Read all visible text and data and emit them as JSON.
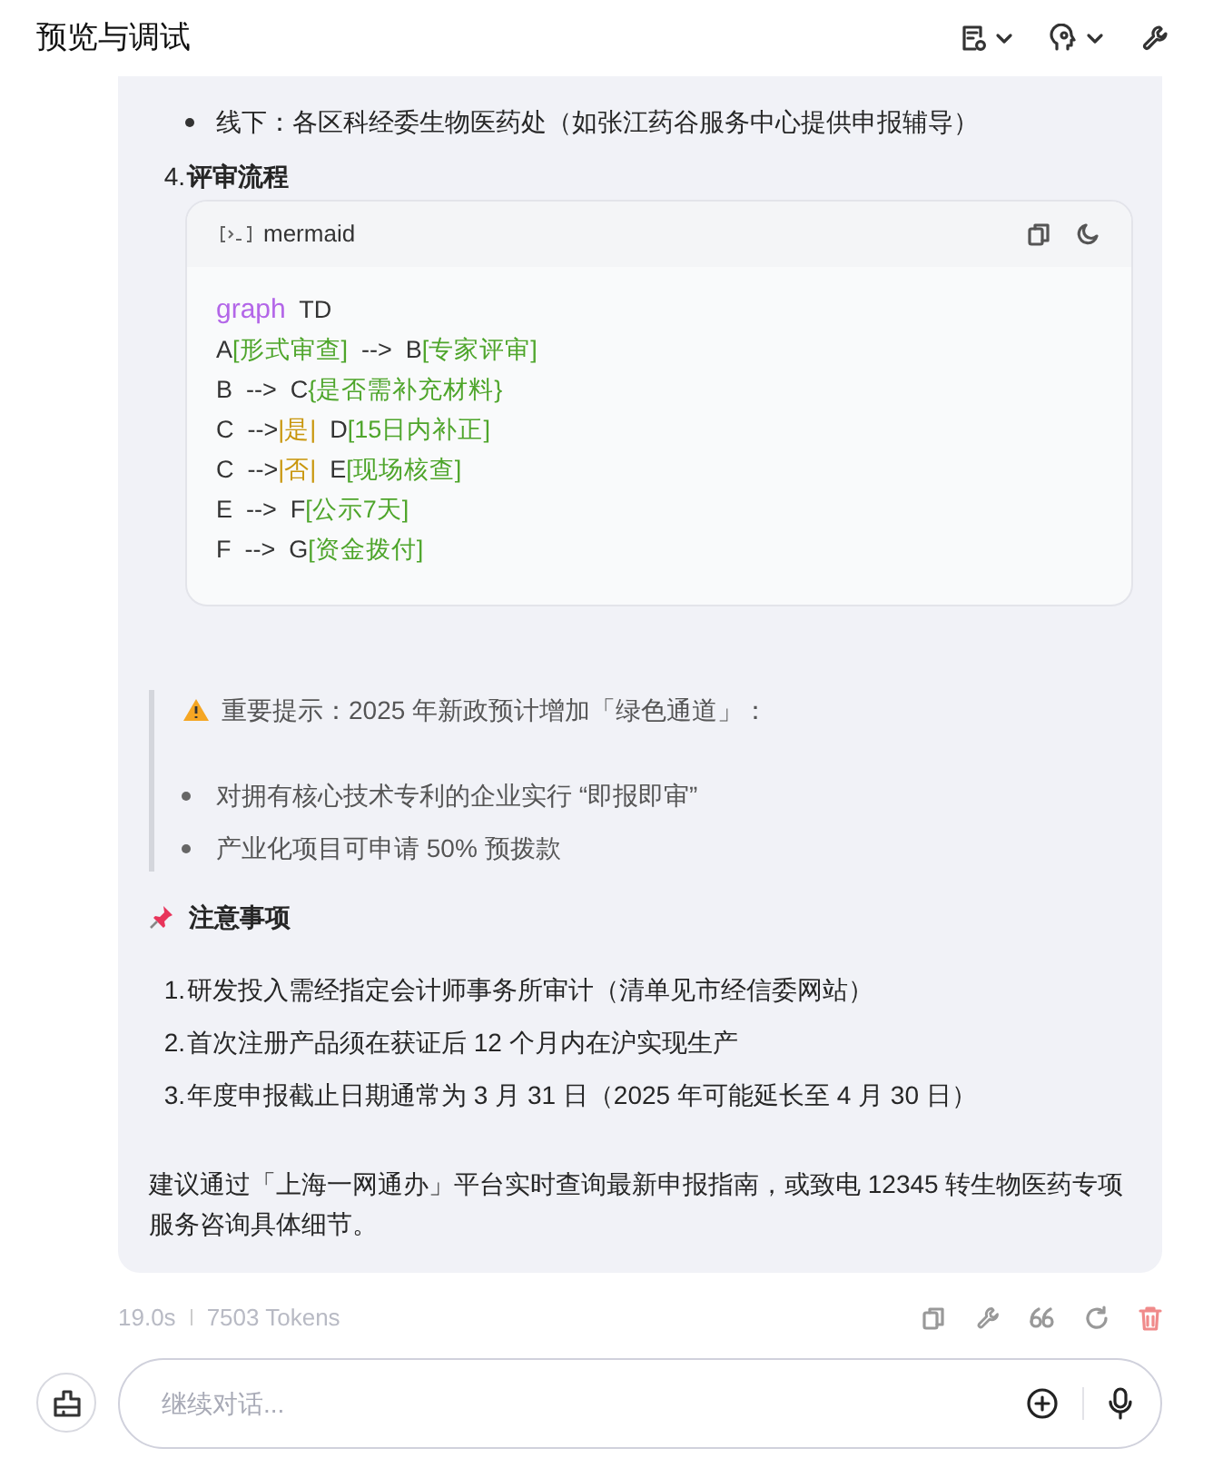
{
  "header": {
    "title": "预览与调试"
  },
  "message": {
    "bullets": [
      "线下：各区科经委生物医药处（如张江药谷服务中心提供申报辅导）"
    ],
    "section": {
      "number": "4.",
      "title": "评审流程"
    },
    "code_block": {
      "language": "mermaid",
      "lines": [
        [
          {
            "kind": "keyword",
            "text": "graph"
          },
          {
            "kind": "plain",
            "text": "  TD"
          }
        ],
        [
          {
            "kind": "plain",
            "text": "A"
          },
          {
            "kind": "string",
            "text": "[形式审查]"
          },
          {
            "kind": "plain",
            "text": "  -->  B"
          },
          {
            "kind": "string",
            "text": "[专家评审]"
          }
        ],
        [
          {
            "kind": "plain",
            "text": "B  -->  C"
          },
          {
            "kind": "string",
            "text": "{是否需补充材料}"
          }
        ],
        [
          {
            "kind": "plain",
            "text": "C  -->"
          },
          {
            "kind": "label",
            "text": "|是|"
          },
          {
            "kind": "plain",
            "text": "  D"
          },
          {
            "kind": "string",
            "text": "[15日内补正]"
          }
        ],
        [
          {
            "kind": "plain",
            "text": "C  -->"
          },
          {
            "kind": "label",
            "text": "|否|"
          },
          {
            "kind": "plain",
            "text": "  E"
          },
          {
            "kind": "string",
            "text": "[现场核查]"
          }
        ],
        [
          {
            "kind": "plain",
            "text": "E  -->  F"
          },
          {
            "kind": "string",
            "text": "[公示7天]"
          }
        ],
        [
          {
            "kind": "plain",
            "text": "F  -->  G"
          },
          {
            "kind": "string",
            "text": "[资金拨付]"
          }
        ]
      ]
    },
    "callout": {
      "title": "重要提示：2025 年新政预计增加「绿色通道」：",
      "bullets": [
        "对拥有核心技术专利的企业实行 “即报即审”",
        "产业化项目可申请 50% 预拨款"
      ]
    },
    "notes": {
      "title": "注意事项",
      "items": [
        {
          "number": "1.",
          "text": "研发投入需经指定会计师事务所审计（清单见市经信委网站）"
        },
        {
          "number": "2.",
          "text": "首次注册产品须在获证后 12 个月内在沪实现生产"
        },
        {
          "number": "3.",
          "text": "年度申报截止日期通常为 3 月 31 日（2025 年可能延长至 4 月 30 日）"
        }
      ]
    },
    "closing": "建议通过「上海一网通办」平台实时查询最新申报指南，或致电 12345 转生物医药专项服务咨询具体细节。"
  },
  "meta": {
    "time": "19.0s",
    "tokens": "7503 Tokens"
  },
  "input": {
    "placeholder": "继续对话..."
  }
}
